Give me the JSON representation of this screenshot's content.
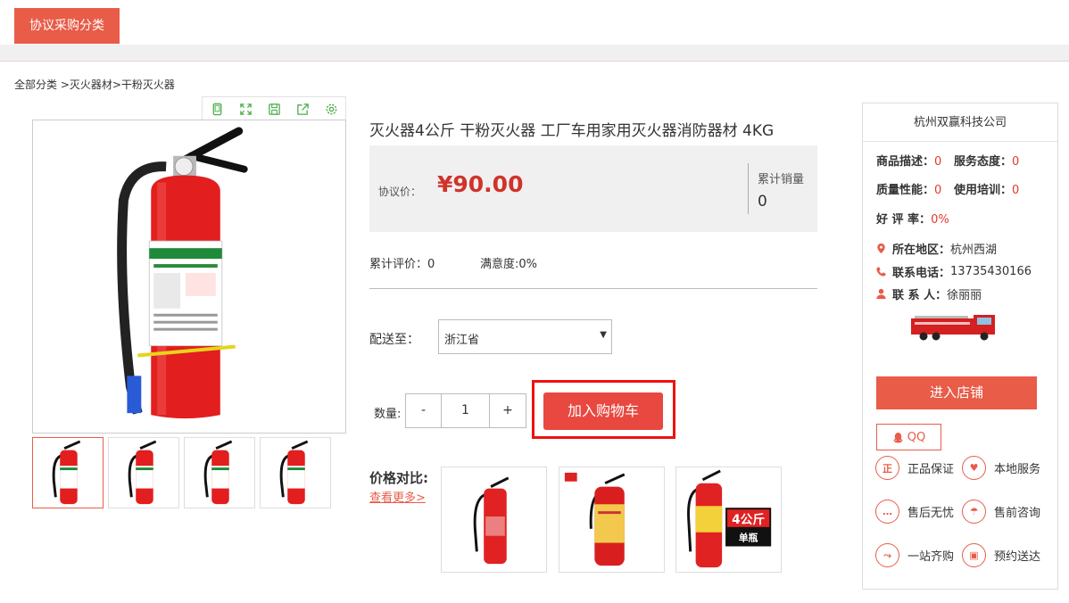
{
  "header": {
    "category_button": "协议采购分类"
  },
  "breadcrumb": "全部分类 >灭火器材>干粉灭火器",
  "gallery": {
    "tools": [
      "phone-icon",
      "fullscreen-icon",
      "save-icon",
      "share-icon",
      "settings-icon"
    ]
  },
  "product": {
    "title": "灭火器4公斤 干粉灭火器 工厂车用家用灭火器消防器材 4KG",
    "price_label": "协议价：",
    "price": "¥90.00",
    "sales_label": "累计销量",
    "sales_value": "0",
    "review": "累计评价：0",
    "satisfaction": "满意度:0%",
    "ship_label": "配送至：",
    "ship_value": "浙江省",
    "qty_label": "数量:",
    "qty_minus": "-",
    "qty_value": "1",
    "qty_plus": "+",
    "cart_button": "加入购物车"
  },
  "compare": {
    "label": "价格对比:",
    "more": "查看更多>",
    "badge_top": "4公斤",
    "badge_bottom": "单瓶"
  },
  "shop": {
    "name": "杭州双赢科技公司",
    "scores": [
      {
        "label": "商品描述：",
        "value": "0"
      },
      {
        "label": "服务态度：",
        "value": "0"
      },
      {
        "label": "质量性能：",
        "value": "0"
      },
      {
        "label": "使用培训：",
        "value": "0"
      },
      {
        "label": "好 评 率：",
        "value": "0%"
      }
    ],
    "region_label": "所在地区：",
    "region_value": "杭州西湖",
    "phone_label": "联系电话：",
    "phone_value": "13735430166",
    "contact_label": "联 系 人：",
    "contact_value": "徐丽丽",
    "enter_button": "进入店铺",
    "qq_label": "QQ",
    "services": [
      "正品保证",
      "本地服务",
      "售后无忧",
      "售前咨询",
      "一站齐购",
      "预约送达"
    ],
    "service_icons": [
      "zheng-icon",
      "bookmark-icon",
      "chat-icon",
      "umbrella-icon",
      "route-icon",
      "gift-icon"
    ]
  },
  "colors": {
    "accent": "#e85c48",
    "price": "#d0332a",
    "highlight": "#ee1111"
  }
}
